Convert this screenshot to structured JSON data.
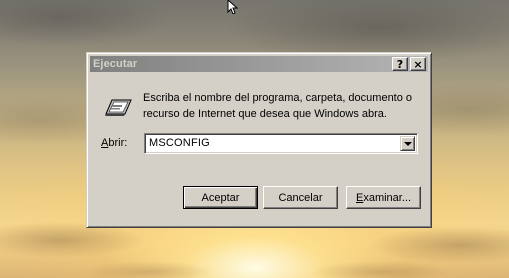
{
  "dialog": {
    "title": "Ejecutar",
    "help_button": "?",
    "close_button": "×",
    "description": "Escriba el nombre del programa, carpeta, documento o recurso de Internet que desea que Windows abra.",
    "open_label_accel": "A",
    "open_label_rest": "brir:",
    "open_value": "MSCONFIG",
    "ok_label": "Aceptar",
    "cancel_label": "Cancelar",
    "browse_label_accel": "E",
    "browse_label_rest": "xaminar..."
  },
  "icons": {
    "run": "run-program-icon",
    "cursor": "mouse-pointer-icon",
    "dropdown": "chevron-down-icon"
  }
}
